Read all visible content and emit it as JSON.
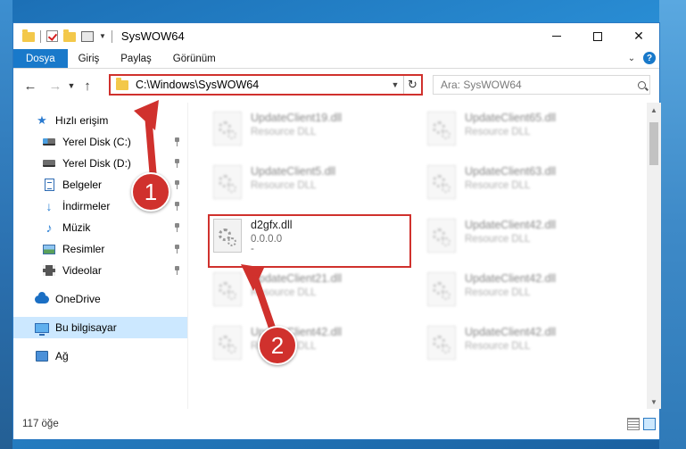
{
  "window": {
    "title": "SysWOW64"
  },
  "ribbon": {
    "tabs": [
      "Dosya",
      "Giriş",
      "Paylaş",
      "Görünüm"
    ]
  },
  "navigation": {
    "address": "C:\\Windows\\SysWOW64",
    "search_placeholder": "Ara: SysWOW64"
  },
  "sidebar": {
    "items": [
      {
        "label": "Hızlı erişim",
        "icon": "star-icon"
      },
      {
        "label": "Yerel Disk (C:)",
        "icon": "drive-icon"
      },
      {
        "label": "Yerel Disk (D:)",
        "icon": "drive-icon"
      },
      {
        "label": "Belgeler",
        "icon": "document-icon"
      },
      {
        "label": "İndirmeler",
        "icon": "download-icon"
      },
      {
        "label": "Müzik",
        "icon": "music-icon"
      },
      {
        "label": "Resimler",
        "icon": "pictures-icon"
      },
      {
        "label": "Videolar",
        "icon": "video-icon"
      },
      {
        "label": "OneDrive",
        "icon": "cloud-icon"
      },
      {
        "label": "Bu bilgisayar",
        "icon": "computer-icon"
      },
      {
        "label": "Ağ",
        "icon": "network-icon"
      }
    ],
    "selected": "Bu bilgisayar"
  },
  "files": [
    {
      "name": "UpdateClient19.dll",
      "sub": "Resource DLL"
    },
    {
      "name": "UpdateClient65.dll",
      "sub": "Resource DLL"
    },
    {
      "name": "UpdateClient5.dll",
      "sub": "Resource DLL"
    },
    {
      "name": "UpdateClient63.dll",
      "sub": "Resource DLL"
    },
    {
      "name": "d2gfx.dll",
      "sub": "0.0.0.0",
      "sub2": "-"
    },
    {
      "name": "UpdateClient42.dll",
      "sub": "Resource DLL"
    },
    {
      "name": "UpdateClient21.dll",
      "sub": "Resource DLL"
    },
    {
      "name": "UpdateClient42.dll",
      "sub": "Resource DLL"
    },
    {
      "name": "UpdateClient42.dll",
      "sub": "Resource DLL"
    },
    {
      "name": "UpdateClient42.dll",
      "sub": "Resource DLL"
    }
  ],
  "status": {
    "item_count": "117 öğe"
  },
  "annotations": {
    "step1": "1",
    "step2": "2"
  },
  "colors": {
    "accent": "#1979ca",
    "highlight": "#d0312d",
    "selected_bg": "#cce8ff"
  }
}
